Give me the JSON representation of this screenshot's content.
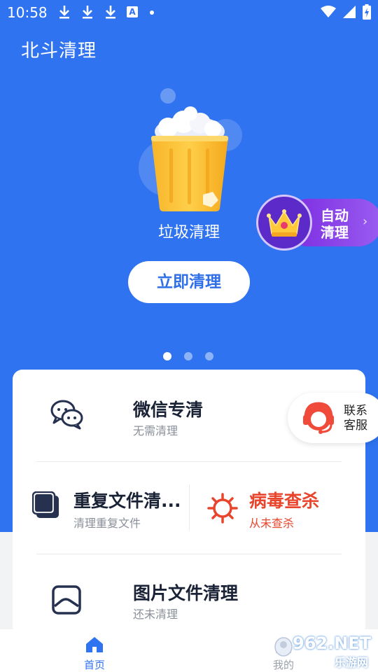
{
  "status": {
    "time": "10:58",
    "badge_letter": "A"
  },
  "app": {
    "title": "北斗清理"
  },
  "hero": {
    "trash_label": "垃圾清理",
    "clean_button": "立即清理",
    "auto_clean": {
      "line1": "自动",
      "line2": "清理"
    },
    "carousel": {
      "count": 3,
      "active": 0
    }
  },
  "support": {
    "line1": "联系",
    "line2": "客服"
  },
  "features": {
    "wechat": {
      "title": "微信专清",
      "subtitle": "无需清理"
    },
    "duplicate": {
      "title": "重复文件清...",
      "subtitle": "清理重复文件"
    },
    "virus": {
      "title": "病毒查杀",
      "subtitle": "从未查杀"
    },
    "images": {
      "title": "图片文件清理",
      "subtitle": "还未清理"
    }
  },
  "tabs": {
    "home": "首页",
    "mine": "我的"
  },
  "watermark": {
    "main": "962.NET",
    "sub": "乐游网"
  },
  "colors": {
    "primary": "#2f73f0",
    "danger": "#e8452c",
    "icon_dark": "#25314f",
    "purple": "#7a2ae0"
  },
  "icons": [
    "download-icon",
    "font-a-icon",
    "wifi-icon",
    "signal-icon",
    "battery-icon",
    "trash-bin-icon",
    "crown-icon",
    "chevron-right-icon",
    "wechat-icon",
    "duplicate-icon",
    "virus-icon",
    "image-icon",
    "headset-agent-icon",
    "home-icon",
    "user-icon"
  ]
}
